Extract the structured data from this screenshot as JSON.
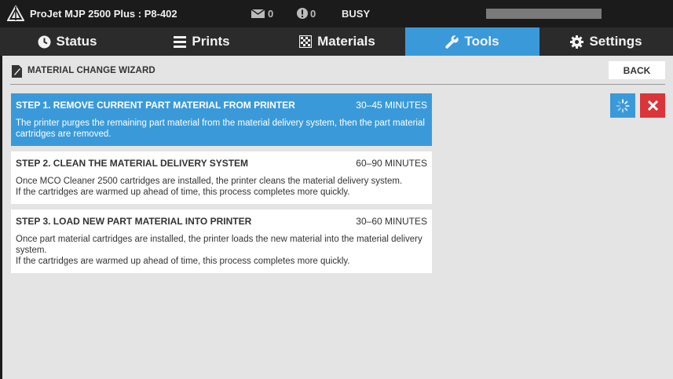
{
  "statusbar": {
    "title": "ProJet MJP 2500 Plus : P8-402",
    "messages_count": "0",
    "alerts_count": "0",
    "state": "BUSY"
  },
  "tabs": [
    {
      "label": "Status",
      "icon": "clock-icon"
    },
    {
      "label": "Prints",
      "icon": "list-icon"
    },
    {
      "label": "Materials",
      "icon": "grid-icon"
    },
    {
      "label": "Tools",
      "icon": "wrench-icon"
    },
    {
      "label": "Settings",
      "icon": "gear-icon"
    }
  ],
  "active_tab": "Tools",
  "wizard": {
    "title": "MATERIAL CHANGE WIZARD",
    "back_label": "BACK"
  },
  "steps": [
    {
      "name": "STEP 1. REMOVE CURRENT PART MATERIAL FROM PRINTER",
      "duration": "30–45 MINUTES",
      "lines": [
        "The printer purges the remaining part material from the material delivery system, then the part material cartridges are removed."
      ]
    },
    {
      "name": "STEP 2. CLEAN THE MATERIAL DELIVERY SYSTEM",
      "duration": "60–90 MINUTES",
      "lines": [
        "Once MCO Cleaner 2500 cartridges are installed, the printer cleans the material delivery system.",
        "If the cartridges are warmed up ahead of time, this process completes more quickly."
      ]
    },
    {
      "name": "STEP 3. LOAD NEW PART MATERIAL INTO PRINTER",
      "duration": "30–60 MINUTES",
      "lines": [
        "Once part material cartridges are installed, the printer loads the new material into the material delivery system.",
        "If the cartridges are warmed up ahead of time, this process completes more quickly."
      ]
    }
  ],
  "colors": {
    "accent": "#3a9ad9",
    "danger": "#d9353a",
    "bar": "#1b1b1b"
  }
}
